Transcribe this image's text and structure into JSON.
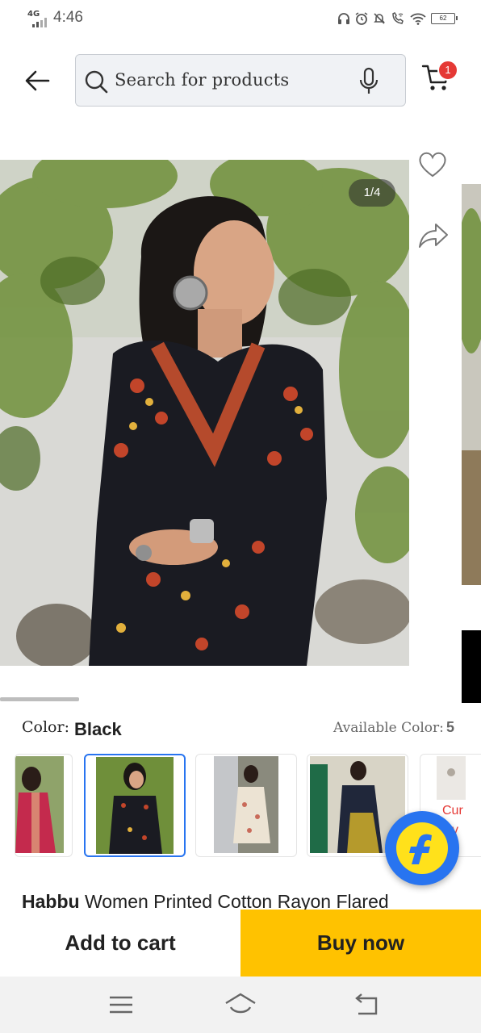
{
  "status_bar": {
    "network": "4G",
    "time": "4:46",
    "battery": "62",
    "icons": [
      "headphones-icon",
      "alarm-icon",
      "mute-icon",
      "wifi-call-icon",
      "wifi-icon",
      "battery-icon"
    ]
  },
  "header": {
    "back_icon": "arrow-left-icon",
    "search_placeholder": "Search for products",
    "mic_icon": "mic-icon",
    "cart_icon": "cart-icon",
    "cart_count": "1"
  },
  "gallery": {
    "page_indicator": "1/4",
    "current_index": 1,
    "total_images": 4,
    "actions": [
      "heart-icon",
      "share-icon"
    ]
  },
  "colors": {
    "label": "Color:",
    "selected": "Black",
    "available_label": "Available Color:",
    "available_count": "5",
    "thumbnails": [
      {
        "name": "red-kurta",
        "selected": false
      },
      {
        "name": "black-kurta",
        "selected": true
      },
      {
        "name": "white-kurta",
        "selected": false
      },
      {
        "name": "mustard-kurta",
        "selected": false
      },
      {
        "name": "partial-kurta",
        "selected": false
      }
    ],
    "partial_label_1": "Cur",
    "partial_label_2": "v"
  },
  "product": {
    "brand": "Habbu",
    "title": " Women Printed Cotton Rayon Flared"
  },
  "actions": {
    "add_to_cart": "Add to cart",
    "buy_now": "Buy now"
  },
  "theme": {
    "accent_blue": "#2874f0",
    "buy_yellow": "#ffc200",
    "badge_red": "#e53935"
  }
}
